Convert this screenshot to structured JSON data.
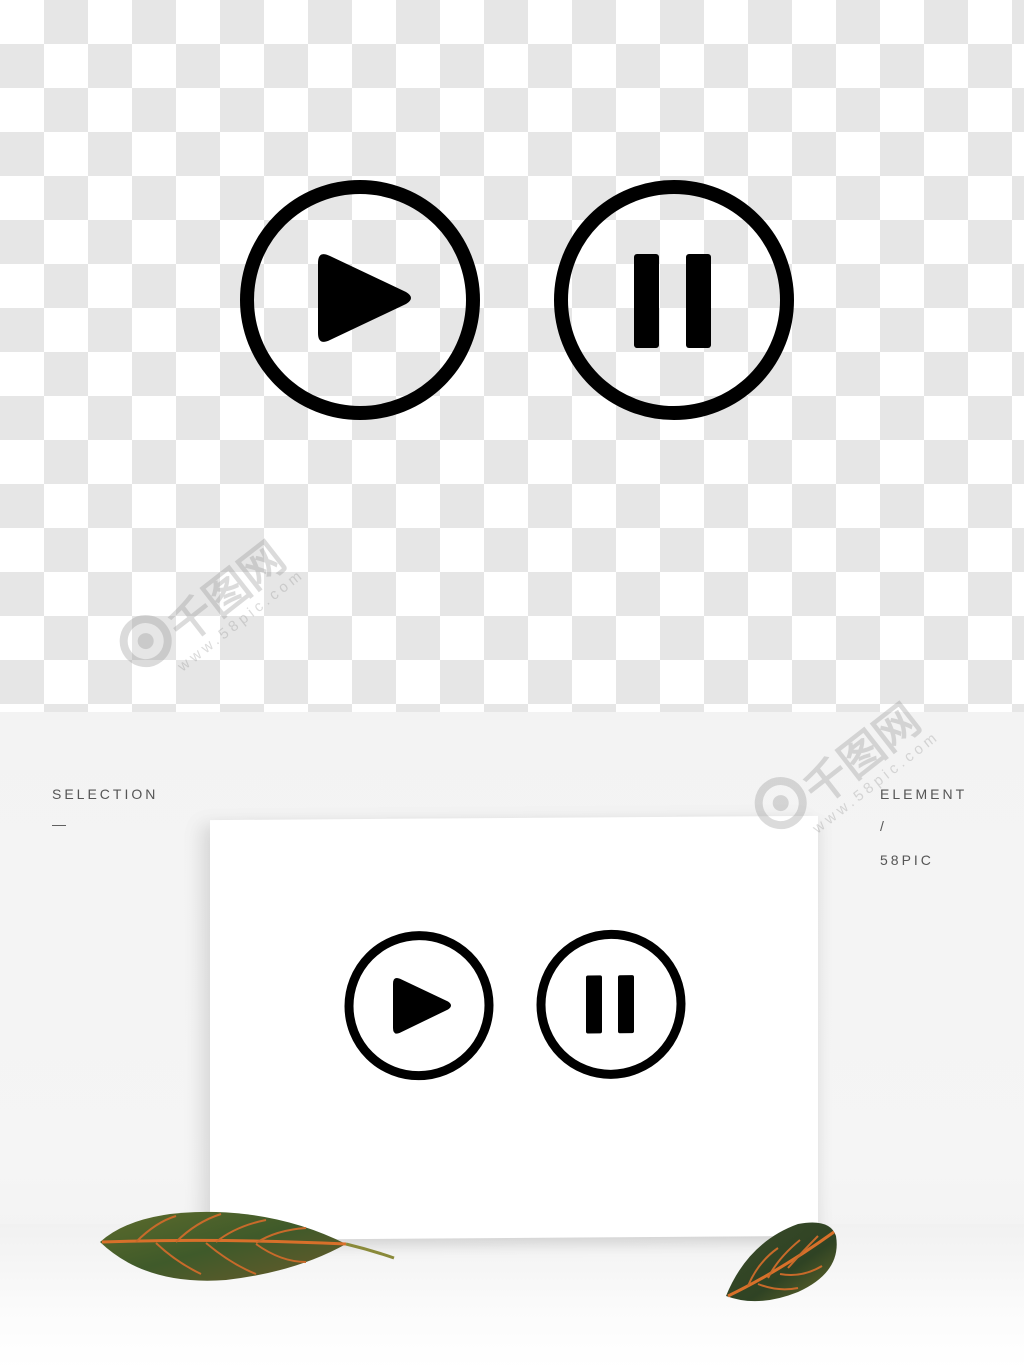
{
  "left_caption": {
    "line1": "SELECTION",
    "line2": "—"
  },
  "right_caption": {
    "line1": "ELEMENT",
    "line2": "/",
    "line3": "58PIC"
  },
  "watermark": {
    "brand": "千图网",
    "url": "www.58pic.com"
  },
  "icons": {
    "play": "play-circle-icon",
    "pause": "pause-circle-icon"
  },
  "colors": {
    "icon": "#000000",
    "checker_light": "#ffffff",
    "checker_dark": "#e6e6e6"
  }
}
